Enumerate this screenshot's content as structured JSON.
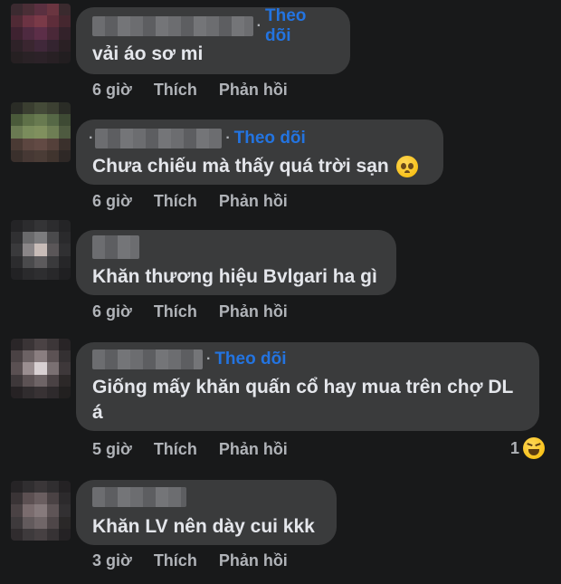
{
  "follow_label": "Theo dõi",
  "like_label": "Thích",
  "reply_label": "Phản hồi",
  "comments": [
    {
      "text": "vải áo sơ mi",
      "time": "6 giờ",
      "has_follow": true
    },
    {
      "text": "Chưa chiếu mà thấy quá trời sạn",
      "emoji": "pleading-face-icon",
      "time": "6 giờ",
      "has_follow": true
    },
    {
      "text": "Khăn thương hiệu Bvlgari ha gì",
      "time": "6 giờ",
      "has_follow": false
    },
    {
      "text_line1": "Giống mấy khăn quấn cổ hay mua trên chợ DL",
      "text_line2": "á",
      "time": "5 giờ",
      "has_follow": true,
      "reaction_count": "1",
      "reaction_icon": "laughing-emoji-icon"
    },
    {
      "text": "Khăn LV nên dày cui kkk",
      "time": "3 giờ",
      "has_follow": false
    }
  ],
  "colors": {
    "background": "#18191a",
    "bubble": "#3a3b3c",
    "follow": "#2374e1",
    "meta": "#b0b3b8"
  }
}
